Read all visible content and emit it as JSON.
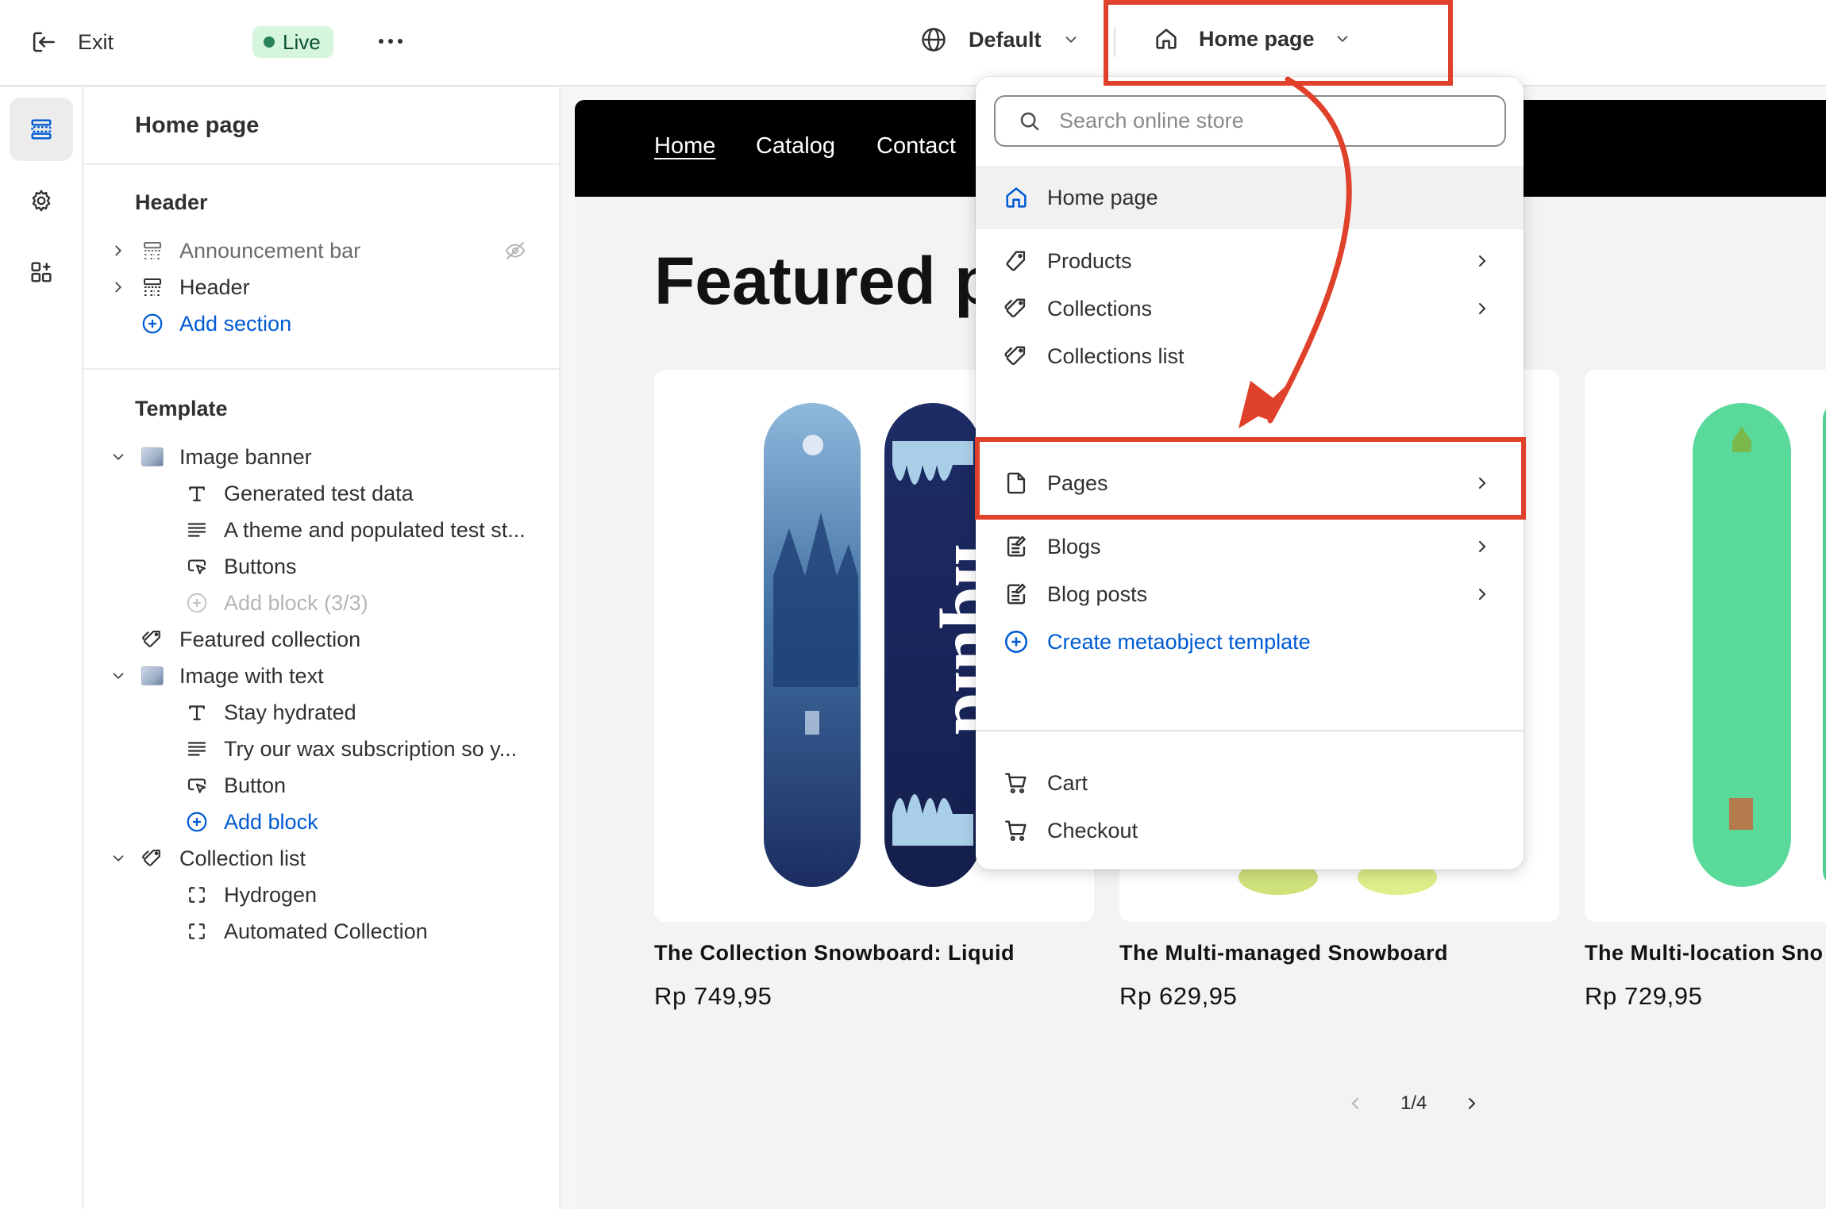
{
  "topbar": {
    "exit_label": "Exit",
    "live_badge": "Live",
    "language_select": "Default",
    "page_select": "Home page"
  },
  "sidebar": {
    "title": "Home page",
    "header_group": {
      "label": "Header",
      "items": [
        {
          "label": "Announcement bar",
          "hidden": true
        },
        {
          "label": "Header"
        }
      ],
      "add_section": "Add section"
    },
    "template_group": {
      "label": "Template",
      "image_banner": {
        "label": "Image banner",
        "blocks": [
          "Generated test data",
          "A theme and populated test st...",
          "Buttons"
        ],
        "add_block": "Add block (3/3)"
      },
      "featured_collection": "Featured collection",
      "image_with_text": {
        "label": "Image with text",
        "blocks": [
          "Stay hydrated",
          "Try our wax subscription so y...",
          "Button"
        ],
        "add_block": "Add block"
      },
      "collection_list": {
        "label": "Collection list",
        "blocks": [
          "Hydrogen",
          "Automated Collection"
        ]
      }
    }
  },
  "preview": {
    "nav": [
      "Home",
      "Catalog",
      "Contact"
    ],
    "title": "Featured p",
    "products": [
      {
        "name": "The Collection Snowboard: Liquid",
        "price": "Rp 749,95"
      },
      {
        "name": "The Multi-managed Snowboard",
        "price": "Rp 629,95"
      },
      {
        "name": "The Multi-location Sno",
        "price": "Rp 729,95"
      }
    ],
    "pager": "1/4"
  },
  "dropdown": {
    "search_placeholder": "Search online store",
    "items": [
      {
        "label": "Home page",
        "icon": "home-icon",
        "selected": true
      },
      {
        "label": "Products",
        "icon": "tag-icon",
        "has_submenu": true
      },
      {
        "label": "Collections",
        "icon": "tags-icon",
        "has_submenu": true
      },
      {
        "label": "Collections list",
        "icon": "tags-icon"
      },
      {
        "label": "Pages",
        "icon": "page-icon",
        "has_submenu": true
      },
      {
        "label": "Blogs",
        "icon": "blog-icon",
        "has_submenu": true
      },
      {
        "label": "Blog posts",
        "icon": "blog-icon",
        "has_submenu": true
      },
      {
        "label": "Create metaobject template",
        "icon": "plus-circle-icon"
      },
      {
        "label": "Cart",
        "icon": "cart-icon"
      },
      {
        "label": "Checkout",
        "icon": "cart-icon"
      }
    ]
  },
  "colors": {
    "annotation": "#e0412a",
    "link": "#005bd3",
    "live_bg": "#d5f5dc",
    "live_dot": "#29845a"
  }
}
